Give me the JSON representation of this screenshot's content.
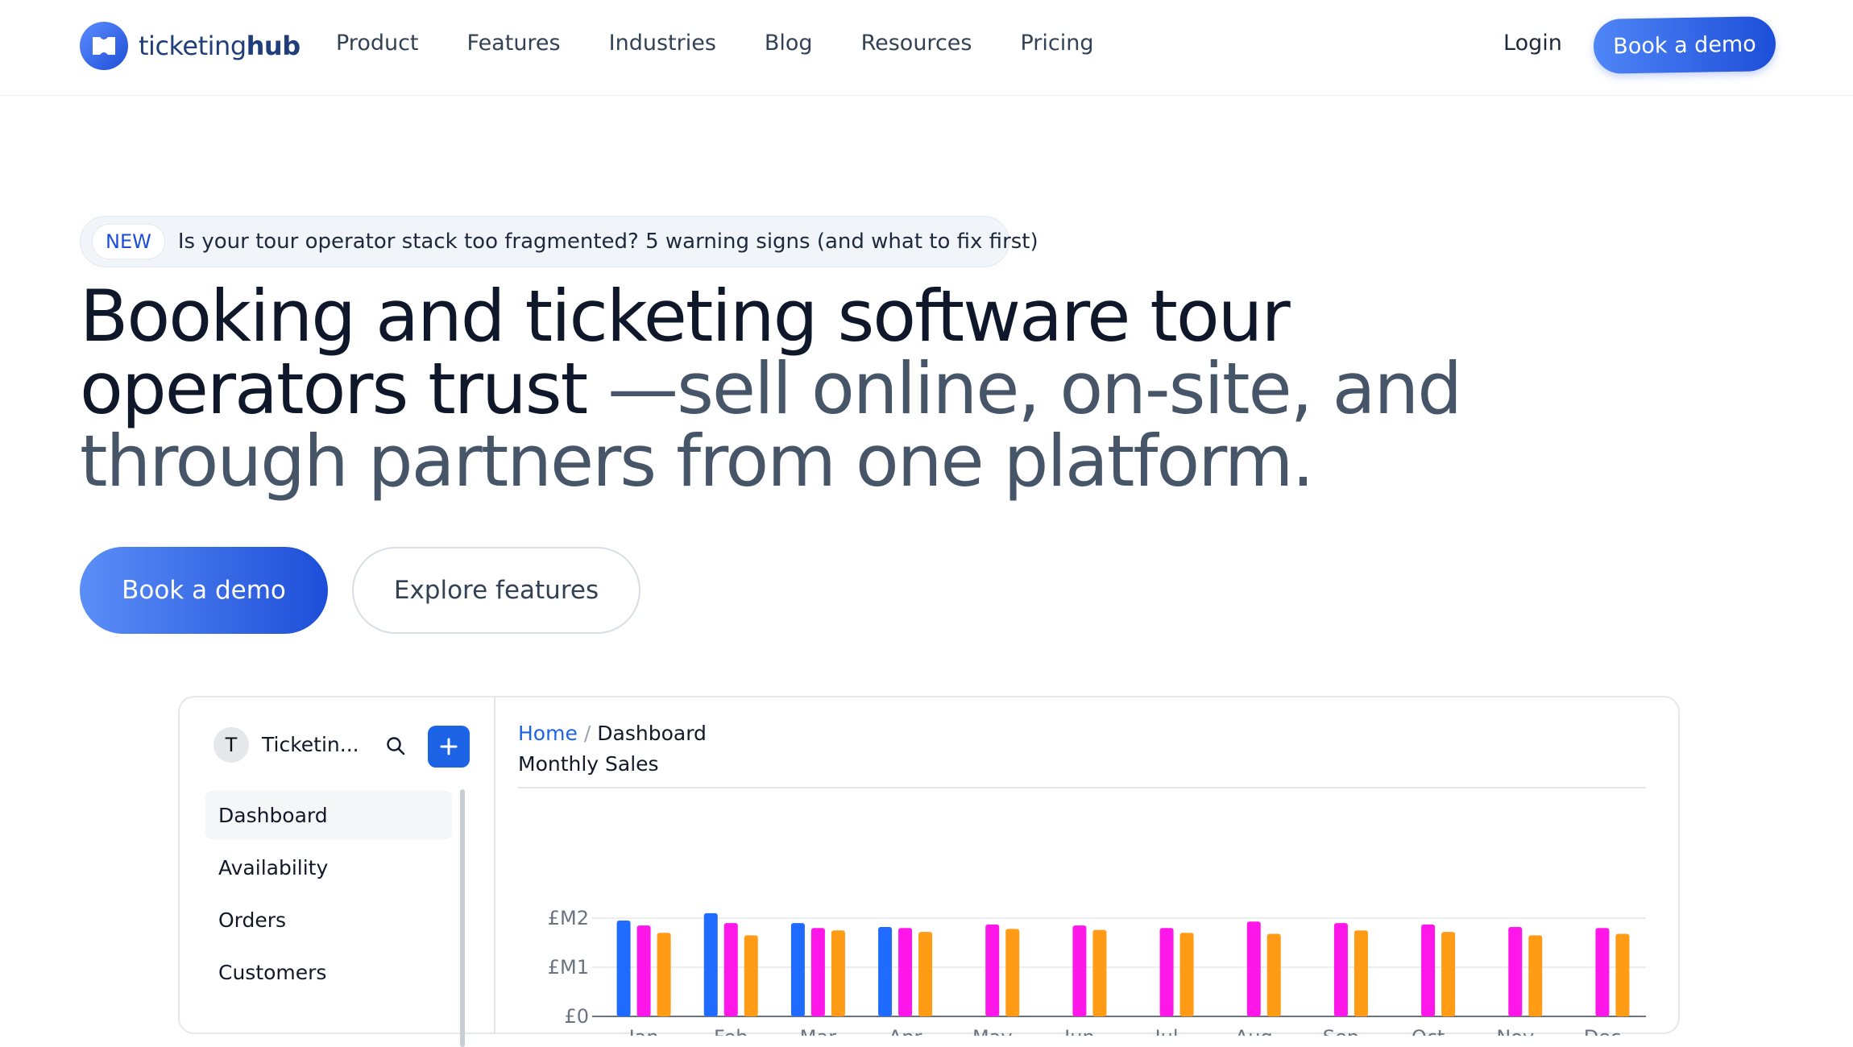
{
  "header": {
    "logo_text_light": "ticketing",
    "logo_text_bold": "hub",
    "nav": [
      "Product",
      "Features",
      "Industries",
      "Blog",
      "Resources",
      "Pricing"
    ],
    "login": "Login",
    "cta": "Book a demo",
    "brand_color": "#1d4ed8"
  },
  "announcement": {
    "badge": "NEW",
    "text": "Is your tour operator stack too fragmented? 5 warning signs (and what to fix first)"
  },
  "hero": {
    "headline_dark": "Booking and ticketing software tour operators trust",
    "headline_muted": " —sell online, on-site, and through partners from one platform.",
    "primary_cta": "Book a demo",
    "secondary_cta": "Explore features"
  },
  "dashboard": {
    "workspace_initial": "T",
    "workspace_name": "Ticketin...",
    "icons": [
      "search-icon",
      "plus-icon"
    ],
    "sidebar": [
      "Dashboard",
      "Availability",
      "Orders",
      "Customers"
    ],
    "active_item": "Dashboard",
    "breadcrumb": {
      "home": "Home",
      "separator": "/",
      "current": "Dashboard"
    },
    "panel_title": "Monthly Sales"
  },
  "chart_data": {
    "type": "bar",
    "title": "Monthly Sales",
    "categories": [
      "Jan",
      "Feb",
      "Mar",
      "Apr",
      "May",
      "Jun",
      "Jul",
      "Aug",
      "Sep",
      "Oct",
      "Nov",
      "Dec"
    ],
    "y_ticks": [
      "£M2",
      "£M1",
      "£0"
    ],
    "y_tick_values": [
      2,
      1,
      0
    ],
    "ylim": [
      0,
      2.4
    ],
    "grid": true,
    "series": [
      {
        "color": "#1f6bff",
        "values": [
          1.95,
          2.1,
          1.9,
          1.82,
          null,
          null,
          null,
          null,
          null,
          null,
          null,
          null
        ]
      },
      {
        "color": "#ff16e8",
        "values": [
          1.85,
          1.9,
          1.8,
          1.8,
          1.87,
          1.85,
          1.8,
          1.93,
          1.9,
          1.87,
          1.82,
          1.8
        ]
      },
      {
        "color": "#ff9b14",
        "values": [
          1.7,
          1.65,
          1.75,
          1.72,
          1.78,
          1.76,
          1.7,
          1.68,
          1.75,
          1.72,
          1.65,
          1.68
        ]
      }
    ]
  }
}
